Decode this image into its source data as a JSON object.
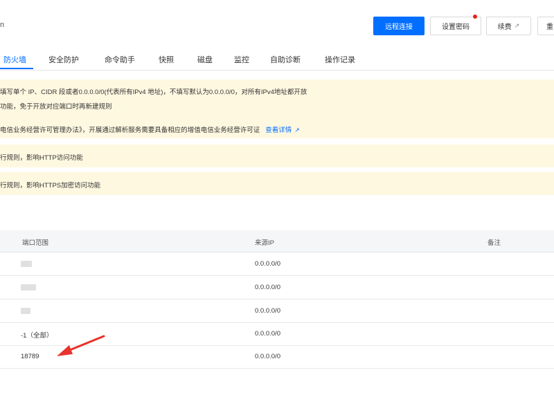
{
  "header": {
    "edge_char": "n",
    "remote_button": "远程连接",
    "password_button": "设置密码",
    "renew_button": "续费",
    "partial_button": "重"
  },
  "tabs": [
    {
      "label": "防火墙",
      "active": true
    },
    {
      "label": "安全防护"
    },
    {
      "label": "命令助手"
    },
    {
      "label": "快照"
    },
    {
      "label": "磁盘"
    },
    {
      "label": "监控"
    },
    {
      "label": "自助诊断"
    },
    {
      "label": "操作记录"
    }
  ],
  "notices": {
    "n1_line1": "填写单个 IP、CIDR 段或者0.0.0.0/0(代表所有IPv4 地址)，不填写默认为0.0.0.0/0，对所有IPv4地址都开放",
    "n1_line2": "功能，免于开放对应端口时再新建规则",
    "n1_line3": "电信业务经营许可管理办法》，开展通过解析服务需要具备相应的增值电信业务经营许可证",
    "n1_link": "查看详情",
    "n2": "行规则，影响HTTP访问功能",
    "n3": "行规则，影响HTTPS加密访问功能"
  },
  "table": {
    "headers": {
      "port": "端口范围",
      "source": "来源IP",
      "note": "备注"
    },
    "rows": [
      {
        "port": "",
        "source": "0.0.0.0/0"
      },
      {
        "port": "",
        "source": "0.0.0.0/0"
      },
      {
        "port": "",
        "source": "0.0.0.0/0"
      },
      {
        "port": "-1（全部）",
        "source": "0.0.0.0/0"
      },
      {
        "port": "18789",
        "source": "0.0.0.0/0"
      }
    ]
  },
  "colors": {
    "accent": "#006eff",
    "notice_bg": "#fff8e1",
    "arrow": "#e8322b",
    "badge": "#e1251b"
  }
}
